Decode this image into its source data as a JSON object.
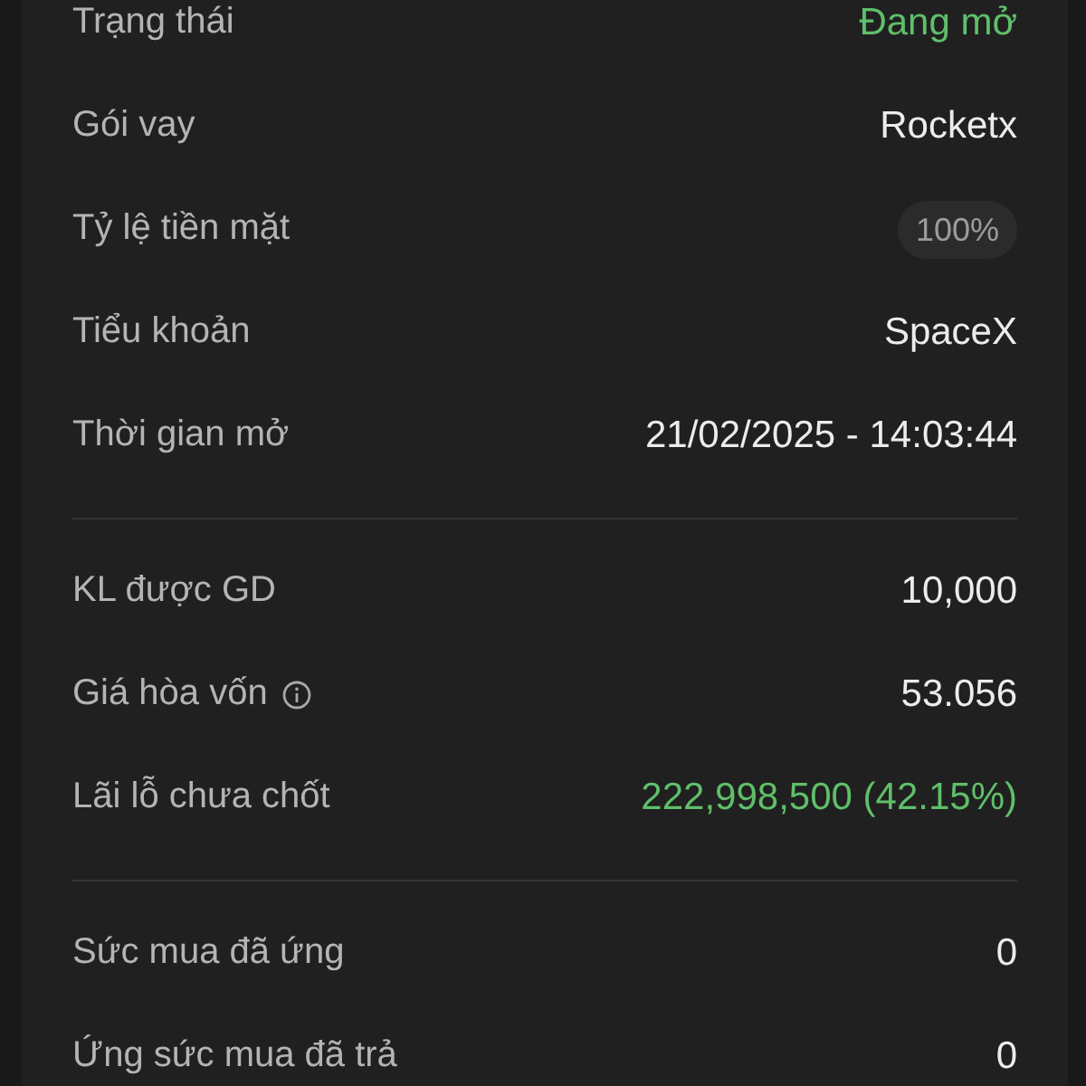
{
  "sections": [
    {
      "rows": [
        {
          "label": "Trạng thái",
          "value": "Đang mở",
          "kind": "positive",
          "has_info": false
        },
        {
          "label": "Gói vay",
          "value": "Rocketx",
          "kind": "plain",
          "has_info": false
        },
        {
          "label": "Tỷ lệ tiền mặt",
          "value": "100%",
          "kind": "pill",
          "has_info": false
        },
        {
          "label": "Tiểu khoản",
          "value": "SpaceX",
          "kind": "plain",
          "has_info": false
        },
        {
          "label": "Thời gian mở",
          "value": "21/02/2025 - 14:03:44",
          "kind": "plain",
          "has_info": false
        }
      ]
    },
    {
      "rows": [
        {
          "label": "KL được GD",
          "value": "10,000",
          "kind": "plain",
          "has_info": false
        },
        {
          "label": "Giá hòa vốn",
          "value": "53.056",
          "kind": "plain",
          "has_info": true
        },
        {
          "label": "Lãi lỗ chưa chốt",
          "value": "222,998,500 (42.15%)",
          "kind": "positive",
          "has_info": false
        }
      ]
    },
    {
      "rows": [
        {
          "label": "Sức mua đã ứng",
          "value": "0",
          "kind": "plain",
          "has_info": false
        },
        {
          "label": "Ứng sức mua đã trả",
          "value": "0",
          "kind": "plain",
          "has_info": false
        }
      ]
    }
  ]
}
